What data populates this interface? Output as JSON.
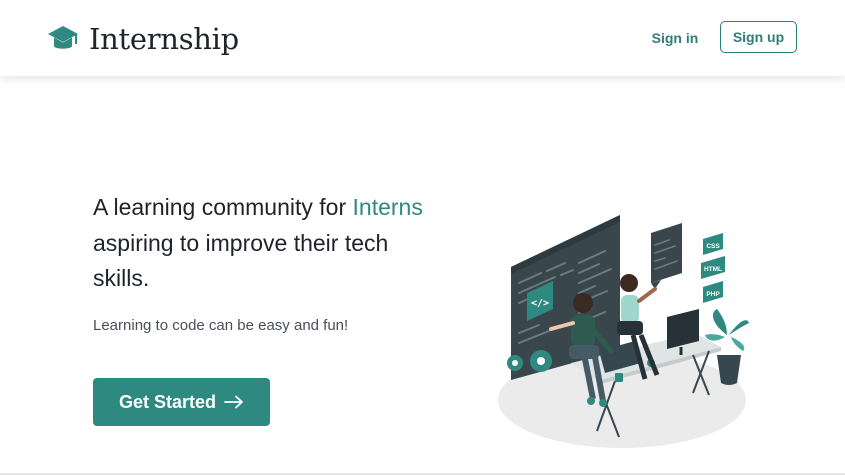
{
  "brand": {
    "name": "Internship",
    "icon": "graduation-cap-icon"
  },
  "nav": {
    "signin": "Sign in",
    "signup": "Sign up"
  },
  "hero": {
    "heading_pre": "A learning community for ",
    "heading_accent": "Interns",
    "heading_post": " aspiring to improve their tech skills.",
    "subtitle": "Learning to code can be easy and fun!",
    "cta": "Get Started",
    "cta_icon": "arrow-right-icon"
  },
  "illustration": {
    "tags": [
      "CSS",
      "HTML",
      "PHP"
    ],
    "code_badge": "</>"
  },
  "colors": {
    "accent": "#2e8a80",
    "text": "#1f2329",
    "muted": "#4a4f57"
  }
}
